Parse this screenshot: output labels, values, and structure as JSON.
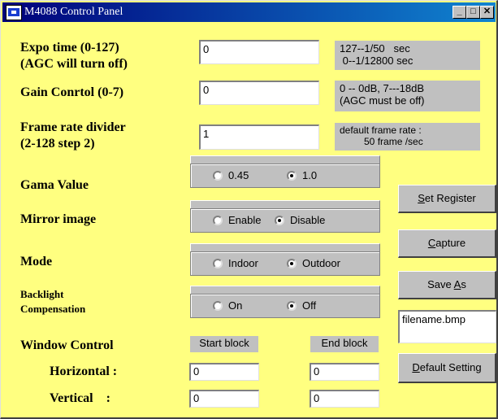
{
  "window": {
    "title": "M4088 Control Panel",
    "min": "_",
    "max": "□",
    "close": "✕"
  },
  "expo": {
    "label1": "Expo time (0-127)",
    "label2": "(AGC will turn off)",
    "value": "0",
    "hint1": "127--1/50   sec",
    "hint2": " 0--1/12800 sec"
  },
  "gain": {
    "label": "Gain Conrtol (0-7)",
    "value": "0",
    "hint1": "0 -- 0dB, 7---18dB",
    "hint2": "(AGC must be off)"
  },
  "frame": {
    "label1": "Frame rate divider",
    "label2": "(2-128 step 2)",
    "value": "1",
    "hint1": "default frame rate :",
    "hint2": "         50 frame /sec"
  },
  "gama": {
    "label": "Gama Value",
    "opt1": "0.45",
    "opt2": "1.0",
    "selected": "1.0"
  },
  "mirror": {
    "label": "Mirror image",
    "opt1": "Enable",
    "opt2": "Disable",
    "selected": "Disable"
  },
  "mode": {
    "label": "Mode",
    "opt1": "Indoor",
    "opt2": "Outdoor",
    "selected": "Outdoor"
  },
  "backlight": {
    "label1": "Backlight",
    "label2": "Compensation",
    "opt1": "On",
    "opt2": "Off",
    "selected": "Off"
  },
  "buttons": {
    "set_register": {
      "pre": "",
      "ul": "S",
      "post": "et Register"
    },
    "capture": {
      "pre": "",
      "ul": "C",
      "post": "apture"
    },
    "save_as": {
      "pre": "Save ",
      "ul": "A",
      "post": "s"
    },
    "default_setting": {
      "pre": "",
      "ul": "D",
      "post": "efault Setting"
    }
  },
  "filename": "filename.bmp",
  "window_control": {
    "label": "Window Control",
    "start_block": "Start block",
    "end_block": "End block",
    "horizontal_label": "Horizontal :",
    "vertical_label": "Vertical    :",
    "h_start": "0",
    "h_end": "0",
    "v_start": "0",
    "v_end": "0"
  }
}
